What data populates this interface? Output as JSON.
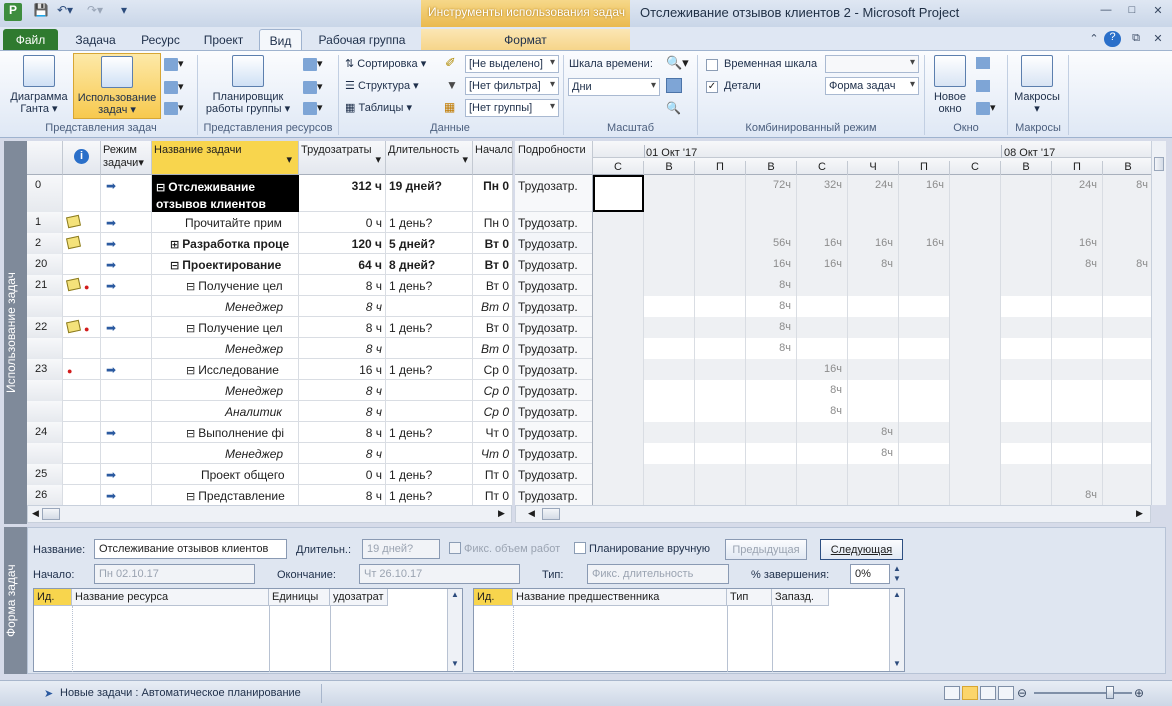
{
  "app": {
    "context_tab_group": "Инструменты использования задач",
    "window_title": "Отслеживание отзывов клиентов 2 - Microsoft Project"
  },
  "tabs": [
    {
      "label": "Файл"
    },
    {
      "label": "Задача"
    },
    {
      "label": "Ресурс"
    },
    {
      "label": "Проект"
    },
    {
      "label": "Вид"
    },
    {
      "label": "Рабочая группа"
    },
    {
      "label": "Формат"
    }
  ],
  "ribbon": {
    "gantt_label": "Диаграмма Ганта",
    "usage_label": "Использование задач",
    "task_views_group": "Представления задач",
    "team_planner_label": "Планировщик работы группы",
    "resource_views_group": "Представления ресурсов",
    "sort_label": "Сортировка",
    "outline_label": "Структура",
    "tables_label": "Таблицы",
    "highlight_value": "[Не выделено]",
    "filter_value": "[Нет фильтра]",
    "group_value": "[Нет группы]",
    "data_group": "Данные",
    "timescale_label": "Шкала времени:",
    "timescale_value": "Дни",
    "zoom_group": "Масштаб",
    "timeline_label": "Временная шкала",
    "details_label": "Детали",
    "details_value": "Форма задач",
    "split_group": "Комбинированный режим",
    "new_window_label": "Новое окно",
    "window_group": "Окно",
    "macros_label": "Макросы",
    "macros_group": "Макросы"
  },
  "side": {
    "usage_title": "Использование задач",
    "form_title": "Форма задач"
  },
  "grid": {
    "headers": {
      "mode": "Режим задачи",
      "name": "Название задачи",
      "work": "Трудозатраты",
      "duration": "Длительность",
      "start": "Начало"
    },
    "rows": [
      {
        "id": "0",
        "name": "Отслеживание отзывов клиентов",
        "work": "312 ч",
        "duration": "19 дней?",
        "start": "Пн 0",
        "kind": "summary0"
      },
      {
        "id": "1",
        "name": "Прочитайте прим",
        "work": "0 ч",
        "duration": "1 день?",
        "start": "Пн 0",
        "kind": "task1"
      },
      {
        "id": "2",
        "name": "Разработка проце",
        "work": "120 ч",
        "duration": "5 дней?",
        "start": "Вт 0",
        "kind": "collapsed"
      },
      {
        "id": "20",
        "name": "Проектирование",
        "work": "64 ч",
        "duration": "8 дней?",
        "start": "Вт 0",
        "kind": "summary"
      },
      {
        "id": "21",
        "name": "Получение цел",
        "work": "8 ч",
        "duration": "1 день?",
        "start": "Вт 0",
        "kind": "sub"
      },
      {
        "id": "",
        "name": "Менеджер",
        "work": "8 ч",
        "duration": "",
        "start": "Вт 0",
        "kind": "assign"
      },
      {
        "id": "22",
        "name": "Получение цел",
        "work": "8 ч",
        "duration": "1 день?",
        "start": "Вт 0",
        "kind": "sub"
      },
      {
        "id": "",
        "name": "Менеджер",
        "work": "8 ч",
        "duration": "",
        "start": "Вт 0",
        "kind": "assign"
      },
      {
        "id": "23",
        "name": "Исследование",
        "work": "16 ч",
        "duration": "1 день?",
        "start": "Ср 0",
        "kind": "sub"
      },
      {
        "id": "",
        "name": "Менеджер",
        "work": "8 ч",
        "duration": "",
        "start": "Ср 0",
        "kind": "assign"
      },
      {
        "id": "",
        "name": "Аналитик",
        "work": "8 ч",
        "duration": "",
        "start": "Ср 0",
        "kind": "assign"
      },
      {
        "id": "24",
        "name": "Выполнение фі",
        "work": "8 ч",
        "duration": "1 день?",
        "start": "Чт 0",
        "kind": "sub"
      },
      {
        "id": "",
        "name": "Менеджер",
        "work": "8 ч",
        "duration": "",
        "start": "Чт 0",
        "kind": "assign"
      },
      {
        "id": "25",
        "name": "Проект общего",
        "work": "0 ч",
        "duration": "1 день?",
        "start": "Пт 0",
        "kind": "task2"
      },
      {
        "id": "26",
        "name": "Представление",
        "work": "8 ч",
        "duration": "1 день?",
        "start": "Пт 0",
        "kind": "sub"
      }
    ]
  },
  "details": {
    "header": "Подробности",
    "row_label": "Трудозатр."
  },
  "timescale": {
    "weeks": [
      "01 Окт '17",
      "08 Окт '17"
    ],
    "days": [
      "С",
      "В",
      "П",
      "В",
      "С",
      "Ч",
      "П",
      "С",
      "В",
      "П",
      "В"
    ],
    "values": [
      [
        "",
        "",
        "",
        "72ч",
        "32ч",
        "24ч",
        "16ч",
        "",
        "",
        "24ч",
        "8ч"
      ],
      [
        "",
        "",
        "",
        "",
        "",
        "",
        "",
        "",
        "",
        "",
        ""
      ],
      [
        "",
        "",
        "",
        "56ч",
        "16ч",
        "16ч",
        "16ч",
        "",
        "",
        "16ч",
        ""
      ],
      [
        "",
        "",
        "",
        "16ч",
        "16ч",
        "8ч",
        "",
        "",
        "",
        "8ч",
        "8ч"
      ],
      [
        "",
        "",
        "",
        "8ч",
        "",
        "",
        "",
        "",
        "",
        "",
        ""
      ],
      [
        "",
        "",
        "",
        "8ч",
        "",
        "",
        "",
        "",
        "",
        "",
        ""
      ],
      [
        "",
        "",
        "",
        "8ч",
        "",
        "",
        "",
        "",
        "",
        "",
        ""
      ],
      [
        "",
        "",
        "",
        "8ч",
        "",
        "",
        "",
        "",
        "",
        "",
        ""
      ],
      [
        "",
        "",
        "",
        "",
        "16ч",
        "",
        "",
        "",
        "",
        "",
        ""
      ],
      [
        "",
        "",
        "",
        "",
        "8ч",
        "",
        "",
        "",
        "",
        "",
        ""
      ],
      [
        "",
        "",
        "",
        "",
        "8ч",
        "",
        "",
        "",
        "",
        "",
        ""
      ],
      [
        "",
        "",
        "",
        "",
        "",
        "8ч",
        "",
        "",
        "",
        "",
        ""
      ],
      [
        "",
        "",
        "",
        "",
        "",
        "8ч",
        "",
        "",
        "",
        "",
        ""
      ],
      [
        "",
        "",
        "",
        "",
        "",
        "",
        "",
        "",
        "",
        "",
        ""
      ],
      [
        "",
        "",
        "",
        "",
        "",
        "",
        "",
        "",
        "",
        "8ч",
        ""
      ]
    ]
  },
  "form": {
    "name_label": "Название:",
    "name_value": "Отслеживание отзывов клиентов",
    "duration_label": "Длительн.:",
    "duration_value": "19 дней?",
    "fixed_effort_label": "Фикс. объем работ",
    "manual_label": "Планирование вручную",
    "prev_label": "Предыдущая",
    "next_label": "Следующая",
    "start_label": "Начало:",
    "start_value": "Пн 02.10.17",
    "finish_label": "Окончание:",
    "finish_value": "Чт 26.10.17",
    "type_label": "Тип:",
    "type_value": "Фикс. длительность",
    "pct_label": "% завершения:",
    "pct_value": "0%",
    "res_headers": [
      "Ид.",
      "Название ресурса",
      "Единицы",
      "удозатрат"
    ],
    "pred_headers": [
      "Ид.",
      "Название предшественника",
      "Тип",
      "Запазд."
    ]
  },
  "status": {
    "new_tasks": "Новые задачи : Автоматическое планирование"
  }
}
